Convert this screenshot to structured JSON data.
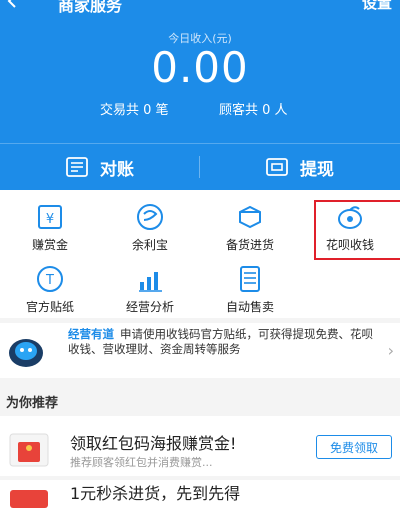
{
  "nav": {
    "title": "商家服务",
    "settings": "设置"
  },
  "income": {
    "label": "今日收入(元)",
    "value": "0.00",
    "transactions": "交易共 0 笔",
    "customers": "顾客共 0 人"
  },
  "actions": {
    "reconcile": "对账",
    "withdraw": "提现"
  },
  "grid": [
    {
      "label": "赚赏金",
      "icon": "reward-voucher-icon"
    },
    {
      "label": "余利宝",
      "icon": "yulibao-icon"
    },
    {
      "label": "备货进货",
      "icon": "delivery-truck-icon"
    },
    {
      "label": "花呗收钱",
      "icon": "huabei-icon"
    },
    {
      "label": "官方贴纸",
      "icon": "sticker-icon"
    },
    {
      "label": "经营分析",
      "icon": "bar-chart-icon"
    },
    {
      "label": "自动售卖",
      "icon": "vending-icon"
    }
  ],
  "banner": {
    "brand": "经营有道",
    "text": "申请使用收钱码官方贴纸，可获得提现免费、花呗收钱、营收理财、资金周转等服务"
  },
  "recommend": {
    "title": "为你推荐",
    "card1": {
      "headline": "领取红包码海报赚赏金!",
      "sub": "推荐顾客领红包并消费赚赏...",
      "button": "免费领取"
    },
    "card2": {
      "headline": "1元秒杀进货，先到先得"
    }
  },
  "colors": {
    "primary": "#1d8ce8",
    "highlight": "#e0202a"
  }
}
